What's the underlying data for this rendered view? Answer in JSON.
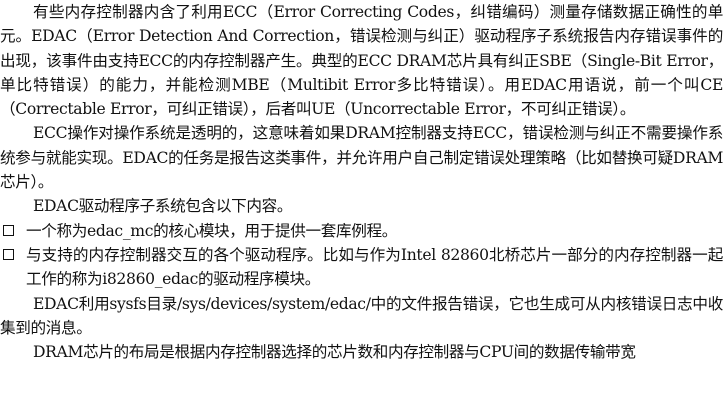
{
  "paragraphs": {
    "p1": "有些内存控制器内含了利用ECC（Error Correcting Codes，纠错编码）测量存储数据正确性的单元。EDAC（Error Detection And Correction，错误检测与纠正）驱动程序子系统报告内存错误事件的出现，该事件由支持ECC的内存控制器产生。典型的ECC DRAM芯片具有纠正SBE（Single-Bit Error，单比特错误）的能力，并能检测MBE（Multibit Error多比特错误）。用EDAC用语说，前一个叫CE（Correctable Error，可纠正错误），后者叫UE（Uncorrectable Error，不可纠正错误）。",
    "p2": "ECC操作对操作系统是透明的，这意味着如果DRAM控制器支持ECC，错误检测与纠正不需要操作系统参与就能实现。EDAC的任务是报告这类事件，并允许用户自己制定错误处理策略（比如替换可疑DRAM芯片）。",
    "p3": "EDAC驱动程序子系统包含以下内容。",
    "p4": "EDAC利用sysfs目录/sys/devices/system/edac/中的文件报告错误，它也生成可从内核错误日志中收集到的消息。",
    "p5": "DRAM芯片的布局是根据内存控制器选择的芯片数和内存控制器与CPU间的数据传输带宽"
  },
  "list_items": [
    "一个称为edac_mc的核心模块，用于提供一套库例程。",
    "与支持的内存控制器交互的各个驱动程序。比如与作为Intel 82860北桥芯片一部分的内存控制器一起工作的称为i82860_edac的驱动程序模块。"
  ]
}
